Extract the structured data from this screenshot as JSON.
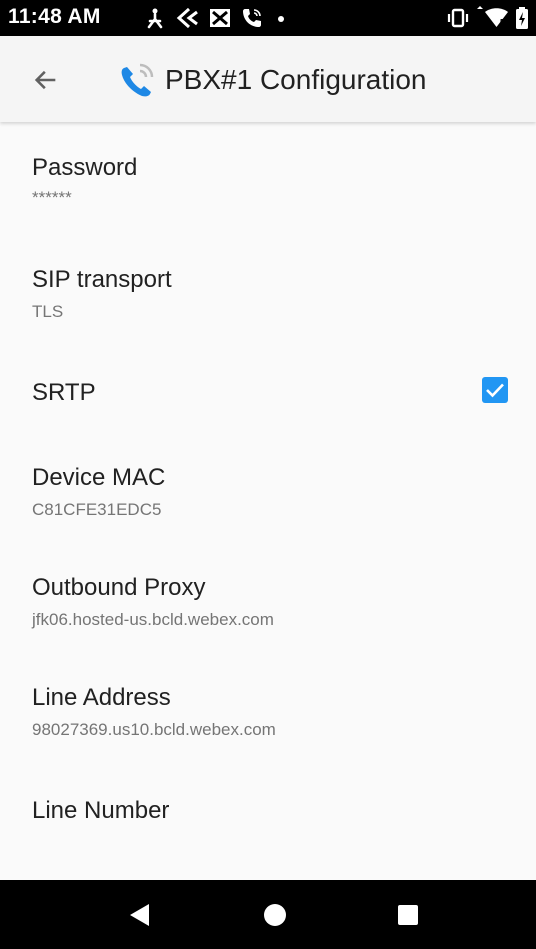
{
  "status_bar": {
    "time": "11:48 AM",
    "icons": [
      "accessibility-icon",
      "feedback-icon",
      "mail-icon",
      "phone-call-icon",
      "dot-icon",
      "vibrate-icon",
      "wifi-icon",
      "battery-charging-icon"
    ]
  },
  "app_bar": {
    "title": "PBX#1 Configuration",
    "back_icon": "arrow-back-icon",
    "app_icon": "phone-wave-icon"
  },
  "preferences": [
    {
      "title": "Password",
      "summary": "******"
    },
    {
      "title": "SIP transport",
      "summary": "TLS"
    },
    {
      "title": "SRTP",
      "checked": true
    },
    {
      "title": "Device MAC",
      "summary": "C81CFE31EDC5"
    },
    {
      "title": "Outbound Proxy",
      "summary": "jfk06.hosted-us.bcld.webex.com"
    },
    {
      "title": "Line Address",
      "summary": "98027369.us10.bcld.webex.com"
    },
    {
      "title": "Line Number"
    }
  ],
  "nav_bar": {
    "buttons": [
      "back-triangle-icon",
      "home-circle-icon",
      "recents-square-icon"
    ]
  },
  "colors": {
    "accent": "#2196f3",
    "status_bar": "#000000",
    "app_bar": "#f5f5f5",
    "background": "#fafafa"
  }
}
